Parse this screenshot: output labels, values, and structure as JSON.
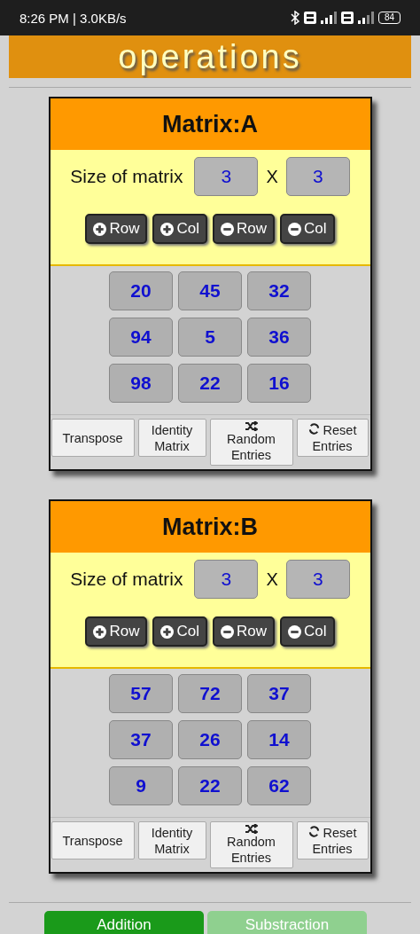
{
  "status_bar": {
    "time": "8:26 PM | 3.0KB/s",
    "battery": "84"
  },
  "banner": {
    "title": "operations"
  },
  "matrices": [
    {
      "title": "Matrix:A",
      "size_label": "Size of matrix",
      "rows": "3",
      "separator": "X",
      "cols": "3",
      "resize_buttons": [
        {
          "kind": "add",
          "label": "Row"
        },
        {
          "kind": "add",
          "label": "Col"
        },
        {
          "kind": "remove",
          "label": "Row"
        },
        {
          "kind": "remove",
          "label": "Col"
        }
      ],
      "entries": [
        [
          "20",
          "45",
          "32"
        ],
        [
          "94",
          "5",
          "36"
        ],
        [
          "98",
          "22",
          "16"
        ]
      ],
      "actions": [
        {
          "kind": "plain",
          "label": "Transpose"
        },
        {
          "kind": "plain",
          "label": "Identity Matrix"
        },
        {
          "kind": "shuffle",
          "label": "Random Entries"
        },
        {
          "kind": "reset",
          "label": "Reset Entries"
        }
      ]
    },
    {
      "title": "Matrix:B",
      "size_label": "Size of matrix",
      "rows": "3",
      "separator": "X",
      "cols": "3",
      "resize_buttons": [
        {
          "kind": "add",
          "label": "Row"
        },
        {
          "kind": "add",
          "label": "Col"
        },
        {
          "kind": "remove",
          "label": "Row"
        },
        {
          "kind": "remove",
          "label": "Col"
        }
      ],
      "entries": [
        [
          "57",
          "72",
          "37"
        ],
        [
          "37",
          "26",
          "14"
        ],
        [
          "9",
          "22",
          "62"
        ]
      ],
      "actions": [
        {
          "kind": "plain",
          "label": "Transpose"
        },
        {
          "kind": "plain",
          "label": "Identity Matrix"
        },
        {
          "kind": "shuffle",
          "label": "Random Entries"
        },
        {
          "kind": "reset",
          "label": "Reset Entries"
        }
      ]
    }
  ],
  "operations": [
    {
      "label": "Addition"
    },
    {
      "label": "Substraction"
    }
  ]
}
